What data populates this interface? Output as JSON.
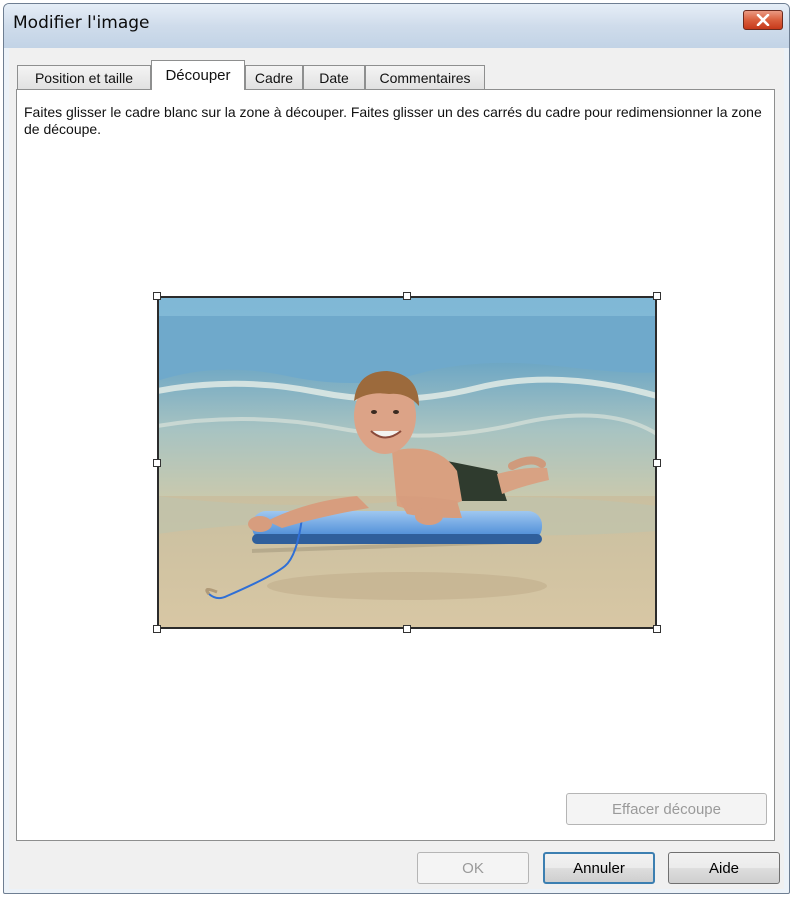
{
  "window": {
    "title": "Modifier l'image"
  },
  "tabs": [
    {
      "label": "Position et taille",
      "active": false
    },
    {
      "label": "Découper",
      "active": true
    },
    {
      "label": "Cadre",
      "active": false
    },
    {
      "label": "Date",
      "active": false
    },
    {
      "label": "Commentaires",
      "active": false
    }
  ],
  "crop_tab": {
    "instructions": "Faites glisser le cadre blanc sur la zone à découper. Faites glisser un des carrés du cadre pour redimensionner la zone de découpe.",
    "clear_crop_label": "Effacer découpe",
    "clear_crop_enabled": false
  },
  "footer": {
    "ok_label": "OK",
    "ok_enabled": false,
    "cancel_label": "Annuler",
    "help_label": "Aide"
  },
  "colors": {
    "close_button": "#d95f3d",
    "default_button_border": "#3c7fb1",
    "disabled_text": "#9a9a9a"
  }
}
